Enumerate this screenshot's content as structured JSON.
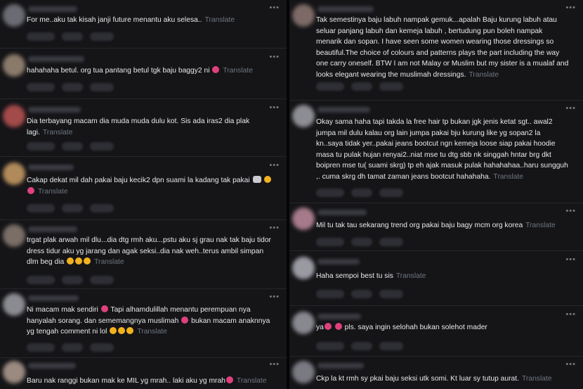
{
  "translate_label": "Translate",
  "more_icon": "more-dots-icon",
  "left_comments": [
    {
      "text": "For me..aku tak kisah janji future menantu aku selesa.."
    },
    {
      "text": "hahahaha betul. org tua pantang betul tgk baju baggy2 ni"
    },
    {
      "text": "Dia terbayang macam dia muda muda dulu kot. Sis ada iras2 dia plak lagi."
    },
    {
      "text": "Cakap dekat mil dah pakai baju kecik2 dpn suami la kadang tak pakai"
    },
    {
      "text": "trgat plak arwah mil dlu...dia dtg rmh aku...pstu aku sj grau nak tak baju tidor dress tidur aku yg jarang dan agak seksi..dia nak weh..terus ambil simpan dlm beg dia"
    },
    {
      "text_a": "Ni macam mak sendiri",
      "text_b": "Tapi alhamdulillah menantu perempuan nya hanyalah sorang. dan sememangnya muslimah",
      "text_c": "bukan macam anaknnya yg tengah comment ni lol"
    },
    {
      "text": "Baru nak ranggi bukan mak ke MIL yg mrah.. laki aku yg mrah"
    }
  ],
  "right_comments": [
    {
      "text": "Tak semestinya baju labuh nampak gemuk...apalah Baju kurung labuh atau seluar panjang labuh dan kemeja labuh , bertudung pun boleh nampak menarik dan sopan. I have seen some women wearing those dressings so beautiful.The choice of colours and patterns plays the part including the way one carry oneself. BTW I am not Malay or Muslim but my sister is a mualaf and looks elegant wearing the muslimah dressings."
    },
    {
      "text": "Okay sama haha tapi takda la free hair tp bukan jgk jenis ketat sgt.. awal2 jumpa mil dulu kalau org lain jumpa pakai bju kurung like yg sopan2 la kn..saya tidak yer..pakai jeans bootcut ngn kemeja loose siap pakai hoodie masa tu pulak hujan renyai2..niat mse tu dtg sbb nk singgah hntar brg dkt boipren mse tu( suami skrg) tp eh ajak masuk pulak hahahahaa..haru sungguh ,. cuma skrg dh tamat zaman jeans bootcut hahahaha."
    },
    {
      "text": "Mil tu tak tau sekarang trend org pakai baju bagy mcm org korea"
    },
    {
      "text": "Haha sempoi best tu sis"
    },
    {
      "text_a": "ya",
      "text_b": "pls. saya ingin selohah bukan solehot mader"
    },
    {
      "text": "Ckp la kt rmh sy pkai baju seksi utk somi. Kt luar sy tutup aurat."
    }
  ]
}
